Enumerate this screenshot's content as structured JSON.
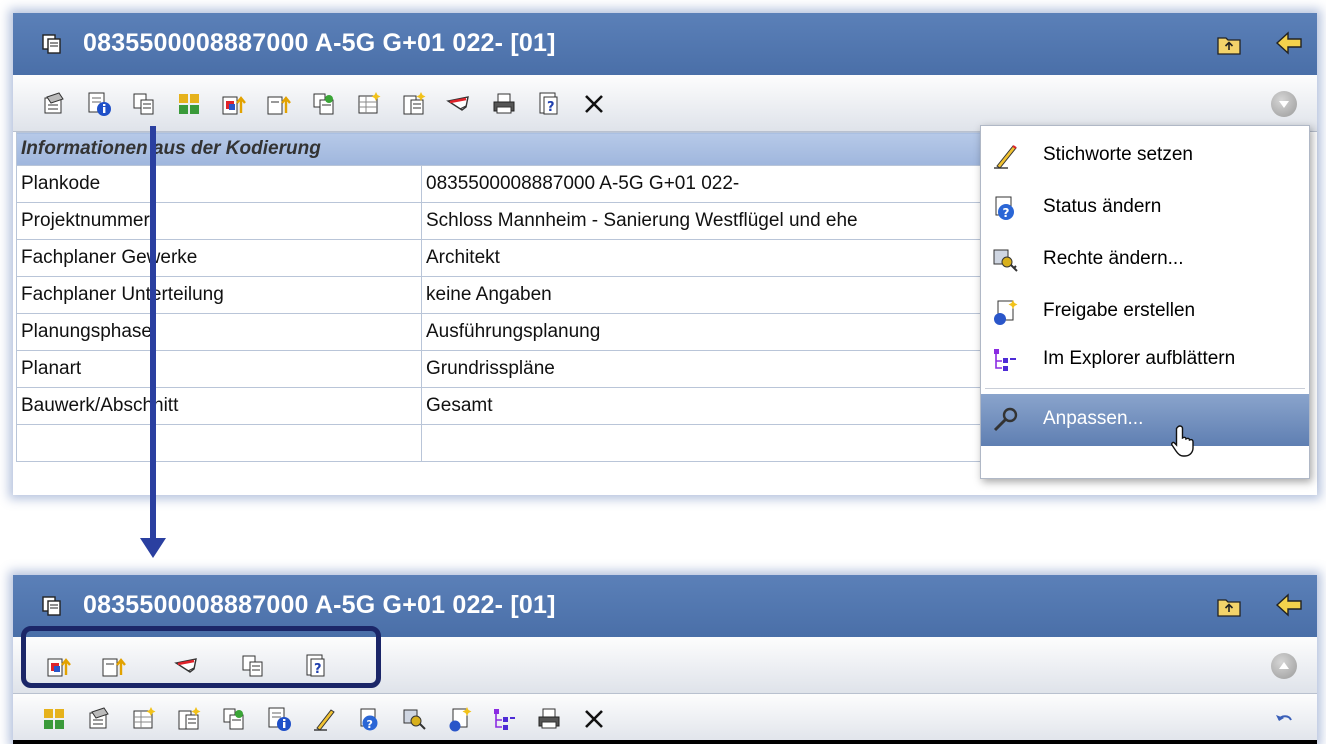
{
  "window": {
    "title": "0835500008887000 A-5G G+01 022- [01]"
  },
  "toolbar_top": {
    "icons": [
      "properties-icon",
      "info-icon",
      "copy-icon",
      "color-grid-icon",
      "upload-red-icon",
      "upload-icon",
      "stamp-icon",
      "table-add-icon",
      "list-add-icon",
      "pen-sign-icon",
      "print-icon",
      "help-doc-icon",
      "close-icon",
      "dropdown-icon"
    ]
  },
  "info_table": {
    "section": "Informationen aus der Kodierung",
    "rows": [
      {
        "label": "Plankode",
        "value": "0835500008887000 A-5G G+01 022-"
      },
      {
        "label": "Projektnummer",
        "value": "Schloss Mannheim - Sanierung Westflügel und ehe"
      },
      {
        "label": "Fachplaner Gewerke",
        "value": "Architekt"
      },
      {
        "label": "Fachplaner Unterteilung",
        "value": "keine Angaben"
      },
      {
        "label": "Planungsphase",
        "value": "Ausführungsplanung"
      },
      {
        "label": "Planart",
        "value": "Grundrisspläne"
      },
      {
        "label": "Bauwerk/Abschnitt",
        "value": "Gesamt"
      }
    ]
  },
  "dropdown_menu": {
    "items": [
      {
        "label": "Stichworte setzen",
        "icon": "pencil-icon"
      },
      {
        "label": "Status ändern",
        "icon": "status-icon"
      },
      {
        "label": "Rechte ändern...",
        "icon": "keys-icon"
      },
      {
        "label": "Freigabe erstellen",
        "icon": "release-icon"
      },
      {
        "label": "Im Explorer aufblättern",
        "icon": "tree-icon"
      },
      {
        "label": "Anpassen...",
        "icon": "wrench-icon",
        "hovered": true
      }
    ]
  },
  "toolbar_bottom_quick": {
    "icons": [
      "upload-red-icon",
      "upload-icon",
      "pen-sign-icon",
      "copy-icon",
      "help-doc-icon"
    ]
  },
  "toolbar_bottom_main": {
    "icons": [
      "color-grid-icon",
      "properties-icon",
      "table-add-icon",
      "list-add-icon",
      "stamp-icon",
      "info-icon",
      "pencil-icon",
      "status-icon",
      "keys-icon",
      "release-icon",
      "tree-icon",
      "print-icon",
      "close-icon",
      "undo-icon"
    ]
  },
  "colors": {
    "titlebar": "#4a6fa8",
    "section_header": "#a9bfe3",
    "highlight_box": "#1b2668",
    "arrow": "#2a3fa0",
    "menu_hover": "#6f8cbd"
  }
}
